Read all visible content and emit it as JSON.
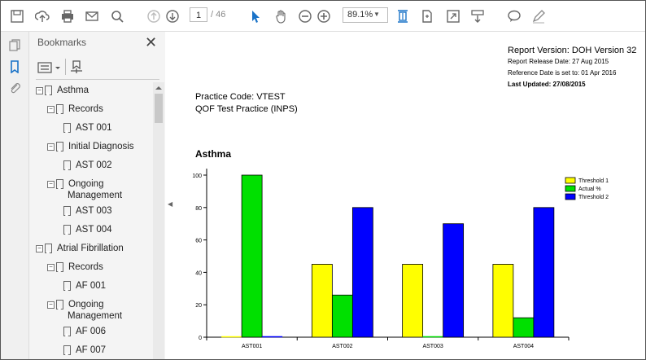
{
  "toolbar": {
    "page_current": "1",
    "page_total": "/ 46",
    "zoom": "89.1%"
  },
  "bookmarks": {
    "title": "Bookmarks",
    "items": [
      {
        "label": "Asthma",
        "expander": "−"
      },
      {
        "label": "Records",
        "expander": "−"
      },
      {
        "label": "AST 001",
        "expander": ""
      },
      {
        "label": "Initial Diagnosis",
        "expander": "−"
      },
      {
        "label": "AST 002",
        "expander": ""
      },
      {
        "label": "Ongoing",
        "label2": "Management",
        "expander": "−"
      },
      {
        "label": "AST 003",
        "expander": ""
      },
      {
        "label": "AST 004",
        "expander": ""
      },
      {
        "label": "Atrial Fibrillation",
        "expander": "−"
      },
      {
        "label": "Records",
        "expander": "−"
      },
      {
        "label": "AF 001",
        "expander": ""
      },
      {
        "label": "Ongoing",
        "label2": "Management",
        "expander": "−"
      },
      {
        "label": "AF 006",
        "expander": ""
      },
      {
        "label": "AF 007",
        "expander": ""
      }
    ]
  },
  "document": {
    "report_version": "Report Version: DOH Version 32",
    "release_date": "Report Release Date: 27 Aug 2015",
    "reference_date": "Reference Date is set to: 01 Apr 2016",
    "last_updated": "Last Updated: 27/08/2015",
    "practice_code": "Practice Code: VTEST",
    "practice_name": "QOF Test Practice (INPS)",
    "section_title": "Asthma"
  },
  "chart_data": {
    "type": "bar",
    "categories": [
      "AST001",
      "AST002",
      "AST003",
      "AST004"
    ],
    "series": [
      {
        "name": "Threshold 1",
        "color": "#ffff00",
        "values": [
          0,
          45,
          45,
          45
        ]
      },
      {
        "name": "Actual %",
        "color": "#00e000",
        "values": [
          100,
          26,
          0,
          12
        ]
      },
      {
        "name": "Threshold 2",
        "color": "#0000ff",
        "values": [
          0,
          80,
          70,
          80
        ]
      }
    ],
    "ylim": [
      0,
      100
    ],
    "yticks": [
      "0",
      "20",
      "40",
      "60",
      "80",
      "100"
    ],
    "legend": "right"
  }
}
